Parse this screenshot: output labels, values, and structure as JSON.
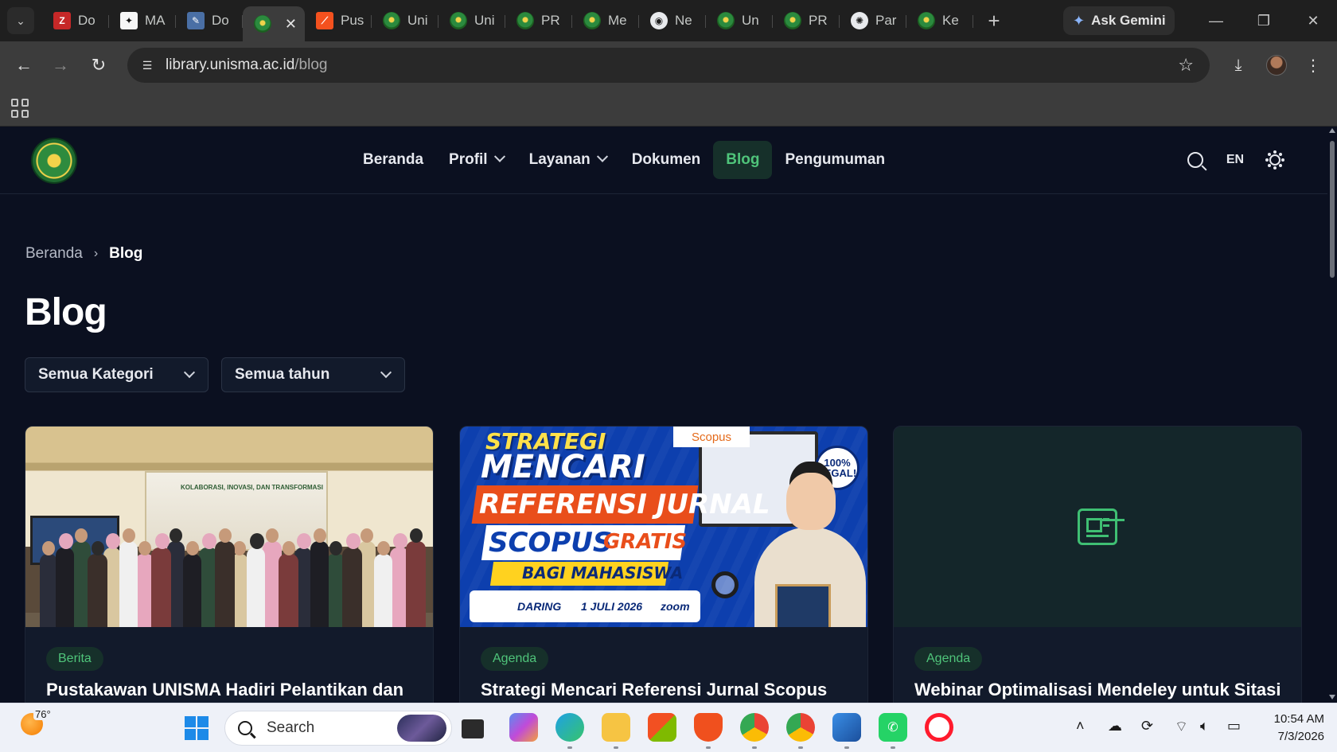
{
  "browser": {
    "tabs": [
      {
        "label": "Do",
        "favicon": "filezilla-icon",
        "active": false
      },
      {
        "label": "MA",
        "favicon": "ma-icon",
        "active": false
      },
      {
        "label": "Do",
        "favicon": "document-icon",
        "active": false
      },
      {
        "label": "",
        "favicon": "unisma-icon",
        "active": true
      },
      {
        "label": "Pus",
        "favicon": "pus-icon",
        "active": false
      },
      {
        "label": "Uni",
        "favicon": "unisma-icon",
        "active": false
      },
      {
        "label": "Uni",
        "favicon": "unisma-icon",
        "active": false
      },
      {
        "label": "PR",
        "favicon": "unisma-icon",
        "active": false
      },
      {
        "label": "Me",
        "favicon": "unisma-icon",
        "active": false
      },
      {
        "label": "Ne",
        "favicon": "chrome-icon",
        "active": false
      },
      {
        "label": "Un",
        "favicon": "unisma-icon",
        "active": false
      },
      {
        "label": "PR",
        "favicon": "unisma-icon",
        "active": false
      },
      {
        "label": "Par",
        "favicon": "chatgpt-icon",
        "active": false
      },
      {
        "label": "Ke",
        "favicon": "unisma-icon",
        "active": false
      }
    ],
    "gemini_label": "Ask Gemini",
    "url_host": "library.unisma.ac.id",
    "url_path": "/blog"
  },
  "site": {
    "nav": {
      "items": [
        {
          "label": "Beranda",
          "has_dropdown": false,
          "active": false
        },
        {
          "label": "Profil",
          "has_dropdown": true,
          "active": false
        },
        {
          "label": "Layanan",
          "has_dropdown": true,
          "active": false
        },
        {
          "label": "Dokumen",
          "has_dropdown": false,
          "active": false
        },
        {
          "label": "Blog",
          "has_dropdown": false,
          "active": true
        },
        {
          "label": "Pengumuman",
          "has_dropdown": false,
          "active": false
        }
      ],
      "lang": "EN"
    },
    "breadcrumb": {
      "home": "Beranda",
      "current": "Blog"
    },
    "title": "Blog",
    "filters": {
      "category": "Semua Kategori",
      "year": "Semua tahun"
    },
    "cards": [
      {
        "badge": "Berita",
        "title": "Pustakawan UNISMA Hadiri Pelantikan dan",
        "image": "photo",
        "banner_text": "KOLABORASI, INOVASI, DAN TRANSFORMASI"
      },
      {
        "badge": "Agenda",
        "title": "Strategi Mencari Referensi Jurnal Scopus",
        "image": "poster",
        "poster": {
          "line1": "STRATEGI",
          "line2": "MENCARI",
          "line3": "REFERENSI JURNAL",
          "line4": "SCOPUS",
          "line4b": "GRATIS",
          "line5": "BAGI MAHASISWA",
          "mode": "DARING",
          "date": "1 JULI 2026",
          "platform": "zoom",
          "scopus_tag": "Scopus",
          "legal": "100% LEGAL!"
        }
      },
      {
        "badge": "Agenda",
        "title": "Webinar Optimalisasi Mendeley untuk Sitasi",
        "image": "newspaper-icon"
      }
    ],
    "accent_color": "#4fc47a"
  },
  "taskbar": {
    "weather_temp": "76°",
    "search_placeholder": "Search",
    "time": "10:54 AM",
    "date": "7/3/2026"
  }
}
